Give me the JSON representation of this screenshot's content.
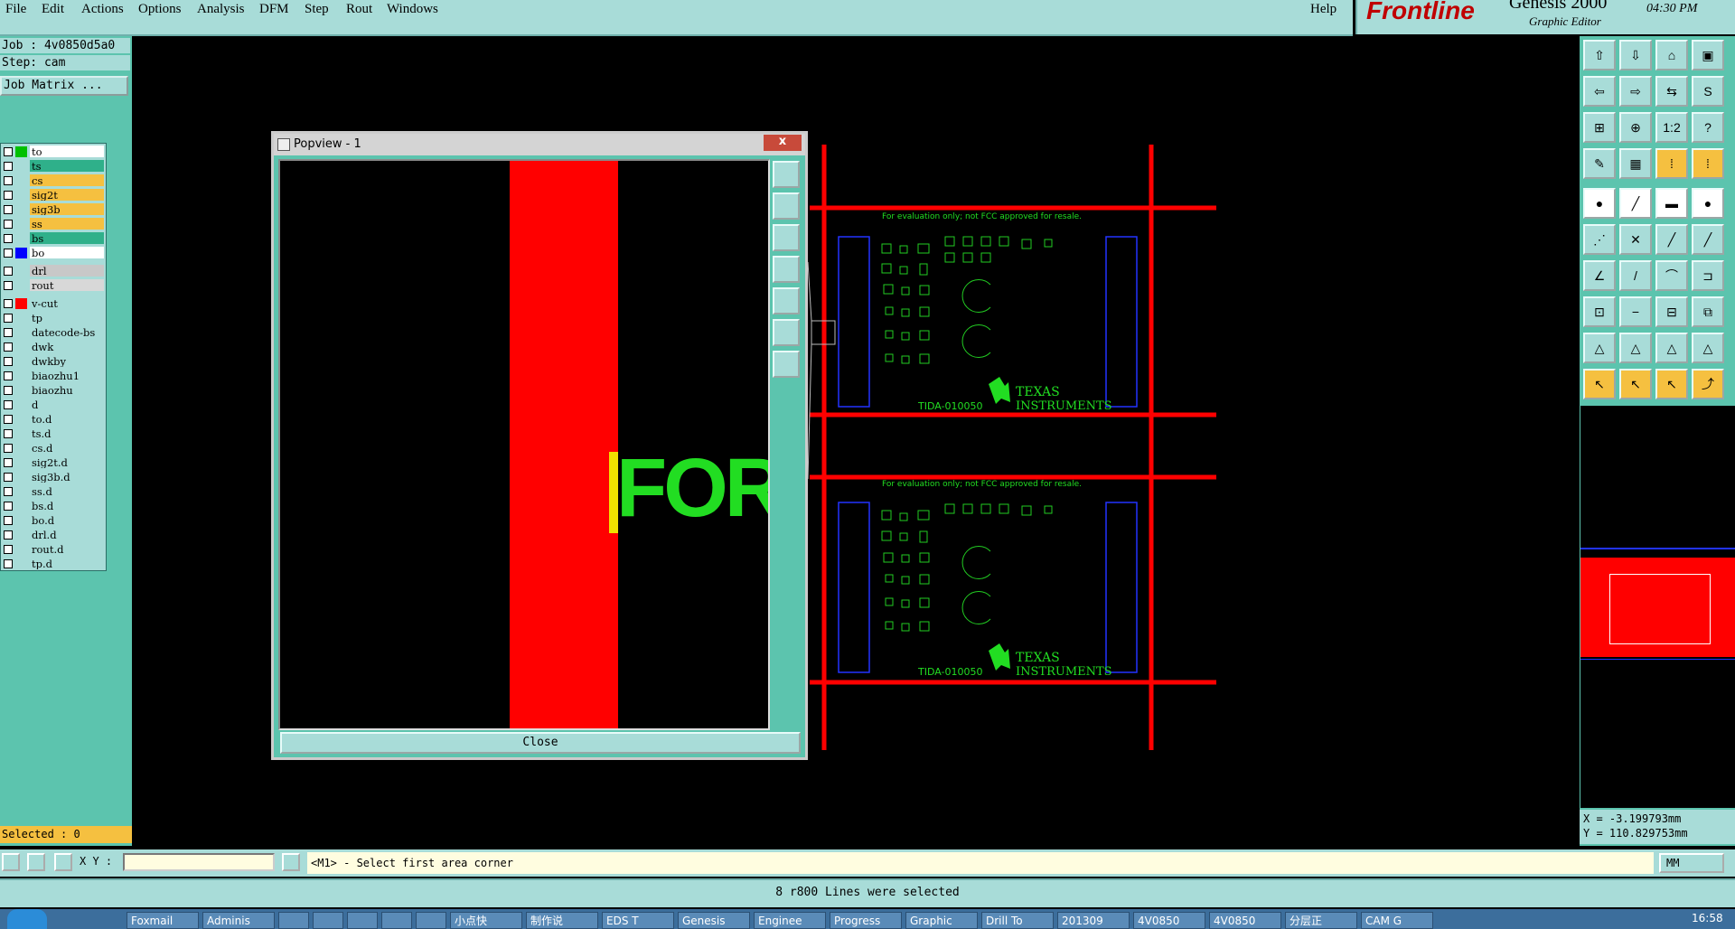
{
  "menu": {
    "items": [
      "File",
      "Edit",
      "Actions",
      "Options",
      "Analysis",
      "DFM",
      "Step",
      "Rout",
      "Windows"
    ],
    "help": "Help"
  },
  "brand": {
    "logo": "Frontline",
    "product": "Genesis 2000",
    "subtitle": "Graphic Editor",
    "clock": "04:30 PM"
  },
  "job": {
    "job_line": "Job : 4v0850d5a0",
    "step_line": "Step: cam",
    "matrix_button": "Job Matrix ..."
  },
  "layers": [
    {
      "name": "to",
      "color": "#00c000",
      "bg": "#ffffff"
    },
    {
      "name": "ts",
      "color": "",
      "bg": "#2fb08a"
    },
    {
      "name": "cs",
      "color": "",
      "bg": "#f5c040"
    },
    {
      "name": "sig2t",
      "color": "",
      "bg": "#f5c040"
    },
    {
      "name": "sig3b",
      "color": "",
      "bg": "#f5c040"
    },
    {
      "name": "ss",
      "color": "",
      "bg": "#f5c040"
    },
    {
      "name": "bs",
      "color": "",
      "bg": "#2fb08a"
    },
    {
      "name": "bo",
      "color": "#0000ff",
      "bg": "#ffffff"
    },
    {
      "name": "drl",
      "color": "",
      "bg": "#c8c8c8"
    },
    {
      "name": "rout",
      "color": "",
      "bg": "#d8d8d8"
    },
    {
      "name": "v-cut",
      "color": "#ff0000",
      "bg": "#a8dcd8"
    },
    {
      "name": "tp",
      "color": "",
      "bg": "#a8dcd8"
    },
    {
      "name": "datecode-bs",
      "color": "",
      "bg": "#a8dcd8"
    },
    {
      "name": "dwk",
      "color": "",
      "bg": "#a8dcd8"
    },
    {
      "name": "dwkby",
      "color": "",
      "bg": "#a8dcd8"
    },
    {
      "name": "biaozhu1",
      "color": "",
      "bg": "#a8dcd8"
    },
    {
      "name": "biaozhu",
      "color": "",
      "bg": "#a8dcd8"
    },
    {
      "name": "d",
      "color": "",
      "bg": "#a8dcd8"
    },
    {
      "name": "to.d",
      "color": "",
      "bg": "#a8dcd8"
    },
    {
      "name": "ts.d",
      "color": "",
      "bg": "#a8dcd8"
    },
    {
      "name": "cs.d",
      "color": "",
      "bg": "#a8dcd8"
    },
    {
      "name": "sig2t.d",
      "color": "",
      "bg": "#a8dcd8"
    },
    {
      "name": "sig3b.d",
      "color": "",
      "bg": "#a8dcd8"
    },
    {
      "name": "ss.d",
      "color": "",
      "bg": "#a8dcd8"
    },
    {
      "name": "bs.d",
      "color": "",
      "bg": "#a8dcd8"
    },
    {
      "name": "bo.d",
      "color": "",
      "bg": "#a8dcd8"
    },
    {
      "name": "drl.d",
      "color": "",
      "bg": "#a8dcd8"
    },
    {
      "name": "rout.d",
      "color": "",
      "bg": "#a8dcd8"
    },
    {
      "name": "tp.d",
      "color": "",
      "bg": "#a8dcd8"
    }
  ],
  "selected_text": "Selected : 0",
  "popview": {
    "title": "Popview - 1",
    "close_label": "Close",
    "close_x": "x",
    "canvas_text": "FOR"
  },
  "board": {
    "notice": "For evaluation only; not FCC approved for resale.",
    "part": "TIDA-010050",
    "vendor_line1": "TEXAS",
    "vendor_line2": "INSTRUMENTS"
  },
  "toolbar": {
    "ratio_label": "1:2",
    "help_label": "?"
  },
  "coords": {
    "x": "X = -3.199793mm",
    "y": "Y = 110.829753mm"
  },
  "command": {
    "xy_label": "X Y :",
    "prompt": "<M1> - Select first area corner",
    "unit": "MM"
  },
  "status": "8 r800 Lines were selected",
  "taskbar": [
    "Foxmail",
    "Adminis",
    "",
    "",
    "",
    "",
    "",
    "小点快",
    "制作说",
    "EDS T",
    "Genesis",
    "Enginee",
    "Progress",
    "Graphic",
    "Drill To",
    "201309",
    "4V0850",
    "4V0850",
    "分层正",
    "CAM G"
  ],
  "tray_time": "16:58"
}
